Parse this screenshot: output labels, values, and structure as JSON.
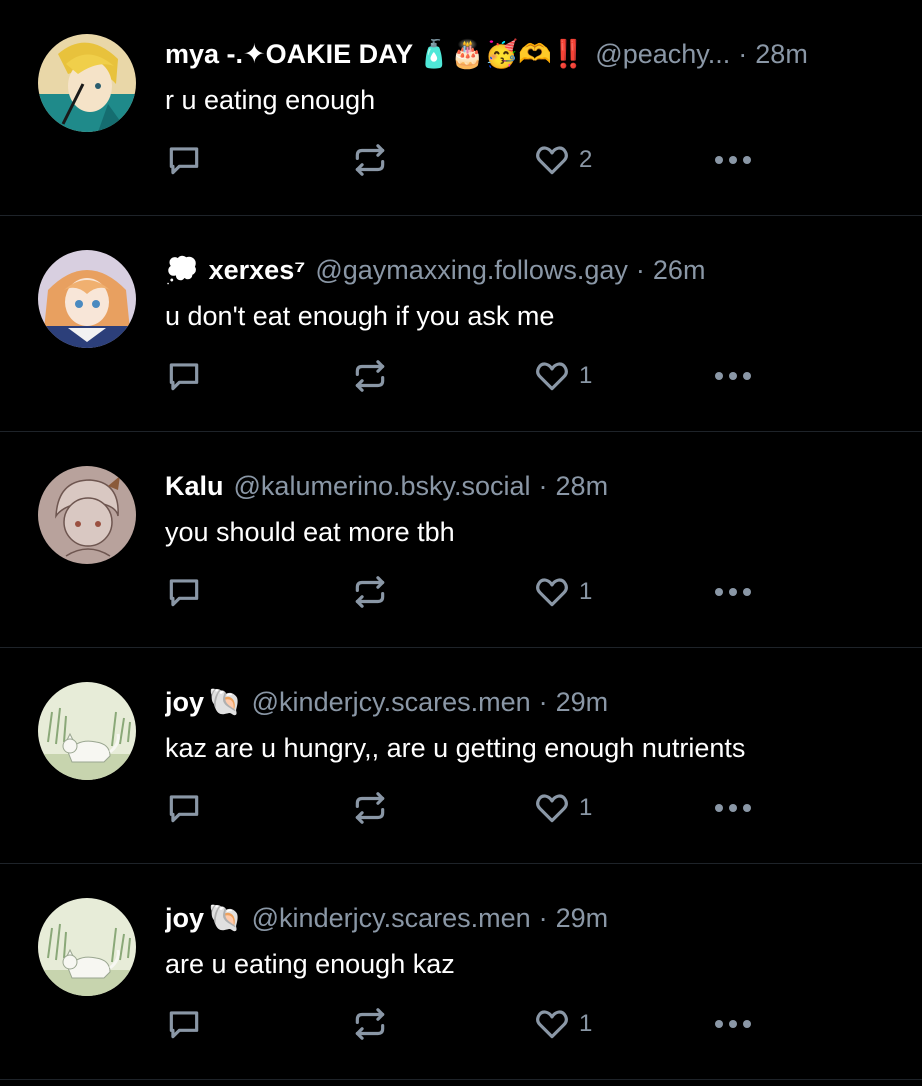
{
  "colors": {
    "background": "#000000",
    "text_primary": "#ffffff",
    "text_secondary": "#8a97a6",
    "divider": "#1e2329"
  },
  "posts": [
    {
      "display_name": "mya -.✦OAKIE DAY",
      "name_emoji": "🧴🎂🥳🫶‼️",
      "handle": "@peachy...",
      "time": "28m",
      "text": "r u eating enough",
      "like_count": "2",
      "avatar_icon": "blonde-anime-character-avatar"
    },
    {
      "name_prefix_emoji": "💭",
      "display_name": "xerxes⁷",
      "name_emoji": "",
      "handle": "@gaymaxxing.follows.gay",
      "time": "26m",
      "text": "u don't eat enough if you ask me",
      "like_count": "1",
      "avatar_icon": "orange-hair-anime-character-avatar"
    },
    {
      "display_name": "Kalu",
      "name_emoji": "",
      "handle": "@kalumerino.bsky.social",
      "time": "28m",
      "text": "you should eat more tbh",
      "like_count": "1",
      "avatar_icon": "sketch-character-avatar"
    },
    {
      "display_name": "joy",
      "name_emoji": "🐚",
      "handle": "@kinderjcy.scares.men",
      "time": "29m",
      "text": "kaz are u hungry,, are u getting enough nutrients",
      "like_count": "1",
      "avatar_icon": "white-cat-in-grass-avatar"
    },
    {
      "display_name": "joy",
      "name_emoji": "🐚",
      "handle": "@kinderjcy.scares.men",
      "time": "29m",
      "text": "are u eating enough kaz",
      "like_count": "1",
      "avatar_icon": "white-cat-in-grass-avatar"
    }
  ]
}
